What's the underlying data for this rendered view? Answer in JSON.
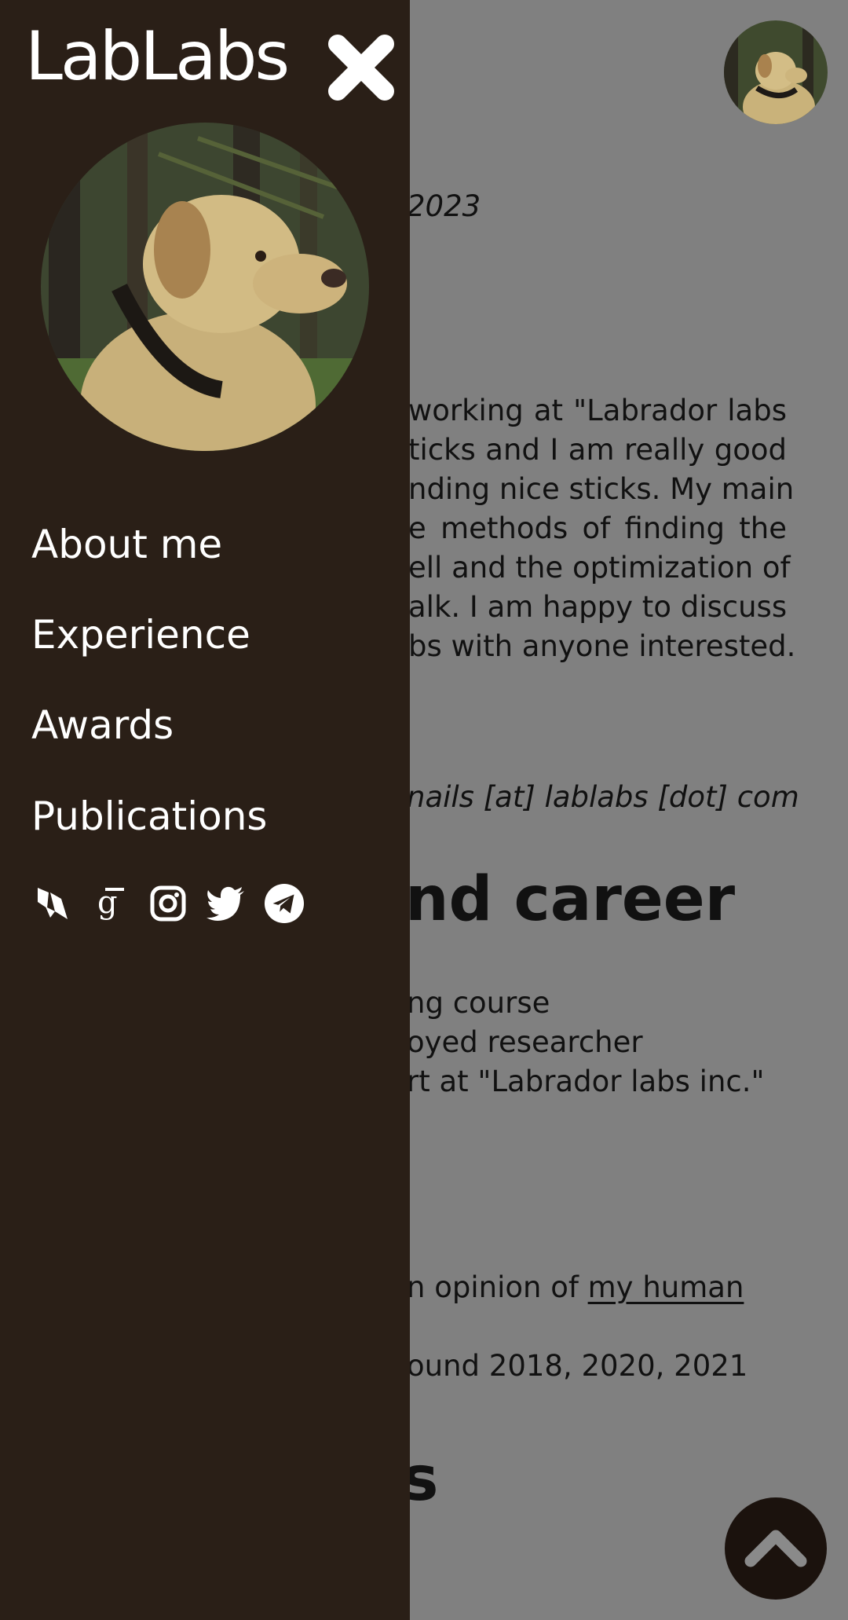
{
  "site": {
    "brand": "LabLabs"
  },
  "nav": {
    "items": [
      {
        "label": "About me"
      },
      {
        "label": "Experience"
      },
      {
        "label": "Awards"
      },
      {
        "label": "Publications"
      }
    ]
  },
  "socials": [
    "researchgate-icon",
    "google-scholar-icon",
    "instagram-icon",
    "twitter-icon",
    "telegram-icon"
  ],
  "background": {
    "date_fragment": "2023",
    "bio_lines": [
      "working at \"Labrador labs",
      "ticks and I am really good",
      "nding nice sticks. My main",
      "e methods of finding the",
      "ell and the optimization of",
      "alk. I am happy to discuss",
      "bs with anyone interested."
    ],
    "email_fragment": "nails [at] lablabs [dot] com",
    "career_heading_fragment": "nd career",
    "career_lines": [
      "ng course",
      "oyed researcher",
      "rt at \"Labrador labs inc.\""
    ],
    "award_prefix": "n opinion of ",
    "award_link": "my human",
    "award_years": "ound 2018, 2020, 2021",
    "publications_heading_fragment": "s"
  },
  "colors": {
    "drawer": "#2a1f17",
    "overlay": "#808080",
    "scroll_button": "#1b120d"
  }
}
